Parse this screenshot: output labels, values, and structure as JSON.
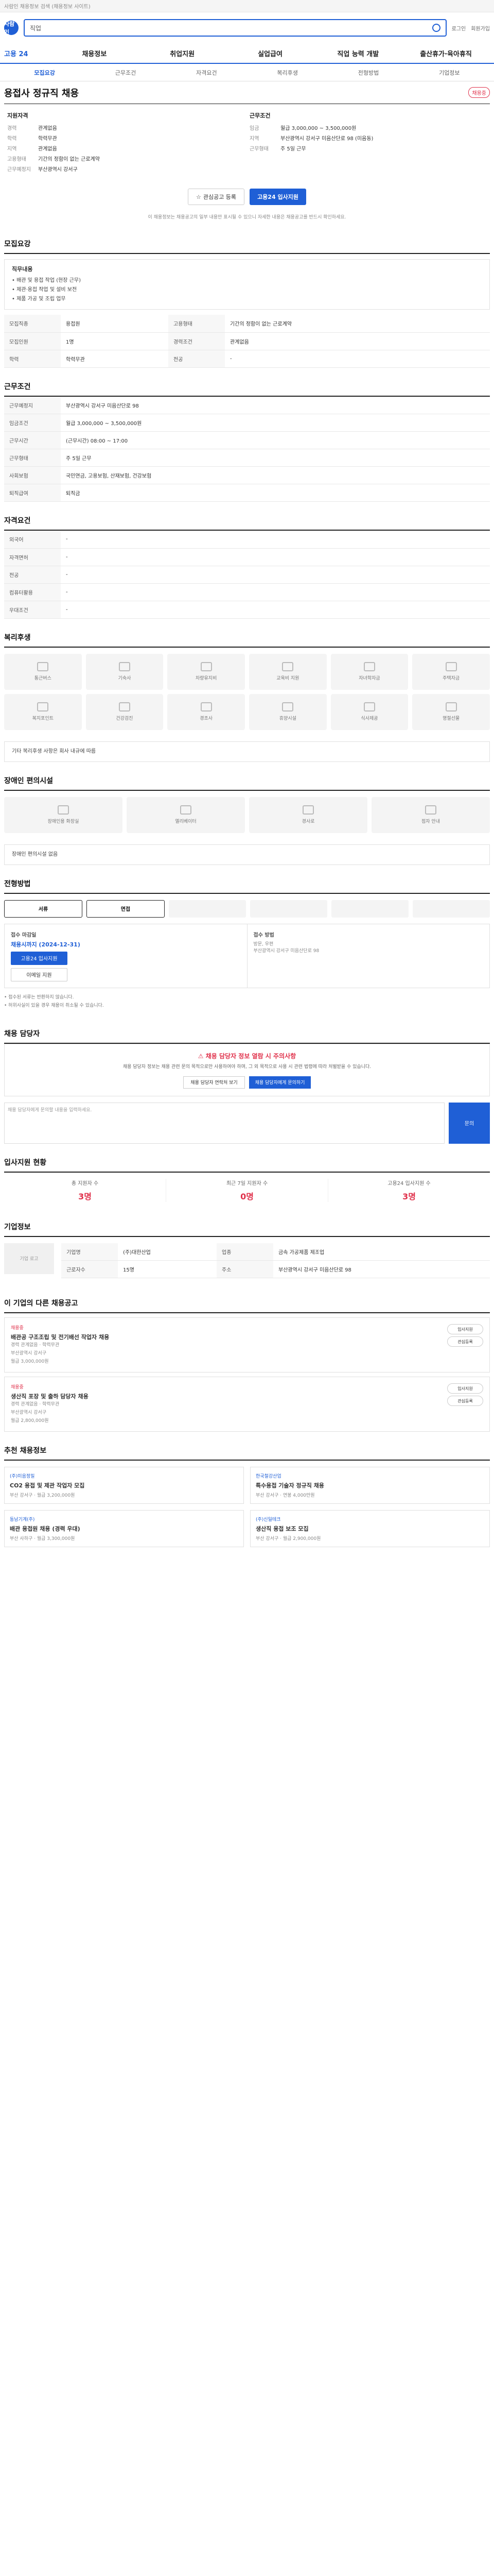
{
  "topbar": {
    "text": "사람인 채용정보 검색 (채용정보 사이트)"
  },
  "header": {
    "logo": "사람인",
    "search_placeholder": "직업",
    "links": [
      "로그인",
      "회원가입"
    ]
  },
  "nav": {
    "brand": "고용 24",
    "items": [
      "채용정보",
      "취업지원",
      "실업급여",
      "직업 능력 개발",
      "출산휴가·육아휴직"
    ]
  },
  "tabs": [
    "모집요강",
    "근무조건",
    "자격요건",
    "복리후생",
    "전형방법",
    "기업정보"
  ],
  "job": {
    "title": "용접사 정규직 채용",
    "badge": "채용중"
  },
  "summary": {
    "left_title": "지원자격",
    "left": [
      {
        "k": "경력",
        "v": "관계없음"
      },
      {
        "k": "학력",
        "v": "학력무관"
      },
      {
        "k": "지역",
        "v": "관계없음"
      },
      {
        "k": "고용형태",
        "v": "기간의 정함이 없는 근로계약"
      },
      {
        "k": "근무예정지",
        "v": "부산광역시 강서구"
      }
    ],
    "right_title": "근무조건",
    "right": [
      {
        "k": "임금",
        "v": "월급 3,000,000 ~ 3,500,000원"
      },
      {
        "k": "지역",
        "v": "부산광역시 강서구 미음산단로 98 (미음동)"
      },
      {
        "k": "근무형태",
        "v": "주 5일 근무"
      }
    ]
  },
  "actions": {
    "scrap": "관심공고 등록",
    "apply": "고용24 입사지원"
  },
  "notice": "이 채용정보는 채용공고의 일부 내용만 표시될 수 있으니 자세한 내용은 채용공고를 반드시 확인하세요.",
  "sections": {
    "recruit": "모집요강",
    "condition": "근무조건",
    "qualify": "자격요건",
    "welfare": "복리후생",
    "disabled": "장애인 편의시설",
    "process": "전형방법",
    "applyinfo": "채용 담당자",
    "stats": "입사지원 현황",
    "company": "기업정보",
    "otherjobs": "이 기업의 다른 채용공고",
    "similar": "추천 채용정보"
  },
  "recruit": {
    "box_title": "직무내용",
    "lines": [
      "• 배관 및 용접 작업 (현장 근무)",
      "• 제관·용접 작업 및 설비 보전",
      "• 제품 가공 및 조립 업무"
    ],
    "rows": [
      {
        "k": "모집직종",
        "v": "용접원"
      },
      {
        "k": "고용형태",
        "v": "기간의 정함이 없는 근로계약"
      },
      {
        "k": "모집인원",
        "v": "1명"
      },
      {
        "k": "경력조건",
        "v": "관계없음"
      },
      {
        "k": "학력",
        "v": "학력무관"
      },
      {
        "k": "전공",
        "v": "-"
      }
    ]
  },
  "condition": {
    "rows": [
      {
        "k": "근무예정지",
        "v": "부산광역시 강서구 미음산단로 98"
      },
      {
        "k": "임금조건",
        "v": "월급 3,000,000 ~ 3,500,000원"
      },
      {
        "k": "근무시간",
        "v": "(근무시간) 08:00 ~ 17:00"
      },
      {
        "k": "근무형태",
        "v": "주 5일 근무"
      },
      {
        "k": "사회보험",
        "v": "국민연금, 고용보험, 산재보험, 건강보험"
      },
      {
        "k": "퇴직급여",
        "v": "퇴직금"
      }
    ]
  },
  "qualify": {
    "rows": [
      {
        "k": "외국어",
        "v": "-"
      },
      {
        "k": "자격면허",
        "v": "-"
      },
      {
        "k": "전공",
        "v": "-"
      },
      {
        "k": "컴퓨터활용",
        "v": "-"
      },
      {
        "k": "우대조건",
        "v": "-"
      }
    ]
  },
  "welfare": {
    "items": [
      "통근버스",
      "기숙사",
      "차량유지비",
      "교육비 지원",
      "자녀학자금",
      "주택자금",
      "복지포인트",
      "건강검진",
      "경조사",
      "휴양시설",
      "식사제공",
      "명절선물"
    ],
    "note": "기타 복리후생 사항은 회사 내규에 따름"
  },
  "disabled": {
    "items": [
      "장애인용 화장실",
      "엘리베이터",
      "경사로",
      "점자 안내"
    ],
    "note": "장애인 편의시설 없음"
  },
  "process": {
    "steps": [
      "서류",
      "면접",
      "",
      "",
      "",
      ""
    ]
  },
  "apply": {
    "left_title": "접수 마감일",
    "time": "채용시까지 (2024-12-31)",
    "btn1": "고용24 입사지원",
    "btn2": "이메일 지원",
    "right_title": "접수 방법",
    "right_lines": [
      "방문, 우편",
      "부산광역시 강서구 미음산단로 98"
    ],
    "foot": [
      "• 접수된 서류는 반환하지 않습니다.",
      "• 허위사실이 있을 경우 채용이 취소될 수 있습니다."
    ]
  },
  "qa": {
    "warn": "채용 담당자 정보 열람 시 주의사항",
    "desc": "채용 담당자 정보는 채용 관련 문의 목적으로만 사용하여야 하며, 그 외 목적으로 사용 시 관련 법령에 따라 처벌받을 수 있습니다.",
    "btn1": "채용 담당자 연락처 보기",
    "btn2": "채용 담당자에게 문의하기",
    "textarea": "채용 담당자에게 문의할 내용을 입력하세요.",
    "submit": "문의"
  },
  "stats": [
    {
      "lbl": "총 지원자 수",
      "num": "3명"
    },
    {
      "lbl": "최근 7일 지원자 수",
      "num": "0명"
    },
    {
      "lbl": "고용24 입사지원 수",
      "num": "3명"
    }
  ],
  "company": {
    "logo": "기업 로고",
    "rows": [
      {
        "k": "기업명",
        "v": "(주)대한산업"
      },
      {
        "k": "업종",
        "v": "금속 가공제품 제조업"
      },
      {
        "k": "근로자수",
        "v": "15명"
      },
      {
        "k": "주소",
        "v": "부산광역시 강서구 미음산단로 98"
      }
    ]
  },
  "otherjobs": [
    {
      "tag": "채용중",
      "title": "배관공 구조조립 및 전기배선 작업자 채용",
      "meta": [
        "경력 관계없음 · 학력무관",
        "부산광역시 강서구",
        "월급 3,000,000원"
      ]
    },
    {
      "tag": "채용중",
      "title": "생산직 포장 및 출하 담당자 채용",
      "meta": [
        "경력 관계없음 · 학력무관",
        "부산광역시 강서구",
        "월급 2,800,000원"
      ]
    }
  ],
  "otherbtn": [
    "입사지원",
    "관심등록"
  ],
  "similar": [
    {
      "t1": "(주)미음정밀",
      "t2": "CO2 용접 및 제관 작업자 모집",
      "t3": "부산 강서구 · 월급 3,200,000원"
    },
    {
      "t1": "한국철강산업",
      "t2": "특수용접 기술자 정규직 채용",
      "t3": "부산 강서구 · 연봉 4,000만원"
    },
    {
      "t1": "동남기계(주)",
      "t2": "배관 용접원 채용 (경력 우대)",
      "t3": "부산 사하구 · 월급 3,300,000원"
    },
    {
      "t1": "(주)신일테크",
      "t2": "생산직 용접 보조 모집",
      "t3": "부산 강서구 · 월급 2,900,000원"
    }
  ]
}
